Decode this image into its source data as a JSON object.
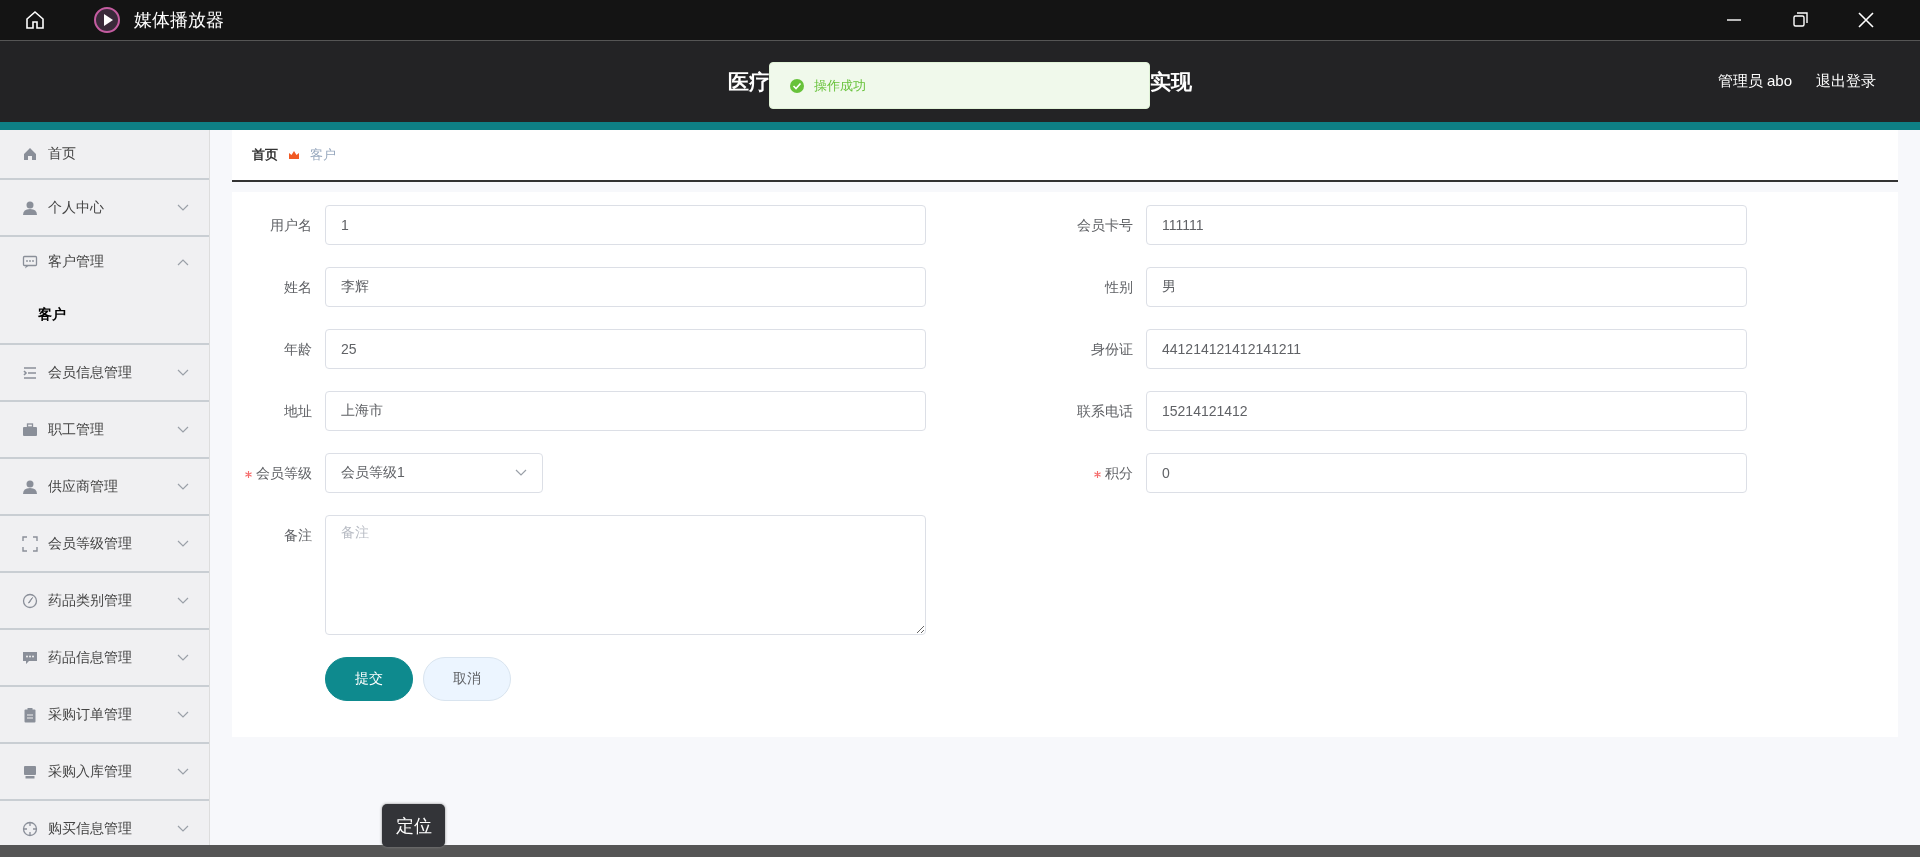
{
  "title_bar": {
    "title": "媒体播放器"
  },
  "header": {
    "title_parts": [
      "医疗",
      "实现"
    ],
    "user": "管理员 abo",
    "logout": "退出登录"
  },
  "toast": {
    "message": "操作成功"
  },
  "sidebar": {
    "items": [
      {
        "label": "首页",
        "kind": "link"
      },
      {
        "label": "个人中心",
        "kind": "menu",
        "expanded": false
      },
      {
        "label": "客户管理",
        "kind": "menu",
        "expanded": true,
        "children": [
          {
            "label": "客户",
            "selected": true
          }
        ]
      },
      {
        "label": "会员信息管理",
        "kind": "menu",
        "expanded": false
      },
      {
        "label": "职工管理",
        "kind": "menu",
        "expanded": false
      },
      {
        "label": "供应商管理",
        "kind": "menu",
        "expanded": false
      },
      {
        "label": "会员等级管理",
        "kind": "menu",
        "expanded": false
      },
      {
        "label": "药品类别管理",
        "kind": "menu",
        "expanded": false
      },
      {
        "label": "药品信息管理",
        "kind": "menu",
        "expanded": false
      },
      {
        "label": "采购订单管理",
        "kind": "menu",
        "expanded": false
      },
      {
        "label": "采购入库管理",
        "kind": "menu",
        "expanded": false
      },
      {
        "label": "购买信息管理",
        "kind": "menu",
        "expanded": false
      }
    ]
  },
  "breadcrumb": [
    "首页",
    "客户"
  ],
  "form": {
    "left": [
      {
        "label": "用户名",
        "kind": "input",
        "value": "1",
        "required": false
      },
      {
        "label": "姓名",
        "kind": "input",
        "value": "李辉",
        "required": false
      },
      {
        "label": "年龄",
        "kind": "input",
        "value": "25",
        "required": false
      },
      {
        "label": "地址",
        "kind": "input",
        "value": "上海市",
        "required": false
      },
      {
        "label": "会员等级",
        "kind": "select",
        "value": "会员等级1",
        "required": true
      },
      {
        "label": "备注",
        "kind": "textarea",
        "placeholder": "备注",
        "required": false
      }
    ],
    "right": [
      {
        "label": "会员卡号",
        "kind": "input",
        "value": "111111",
        "required": false
      },
      {
        "label": "性别",
        "kind": "input",
        "value": "男",
        "required": false
      },
      {
        "label": "身份证",
        "kind": "input",
        "value": "441214121412141211",
        "required": false
      },
      {
        "label": "联系电话",
        "kind": "input",
        "value": "15214121412",
        "required": false
      },
      {
        "label": "积分",
        "kind": "input",
        "value": "0",
        "required": true
      }
    ],
    "buttons": [
      {
        "label": "提交",
        "kind": "primary"
      },
      {
        "label": "取消",
        "kind": "default"
      }
    ]
  },
  "tooltip": {
    "text": "定位"
  }
}
